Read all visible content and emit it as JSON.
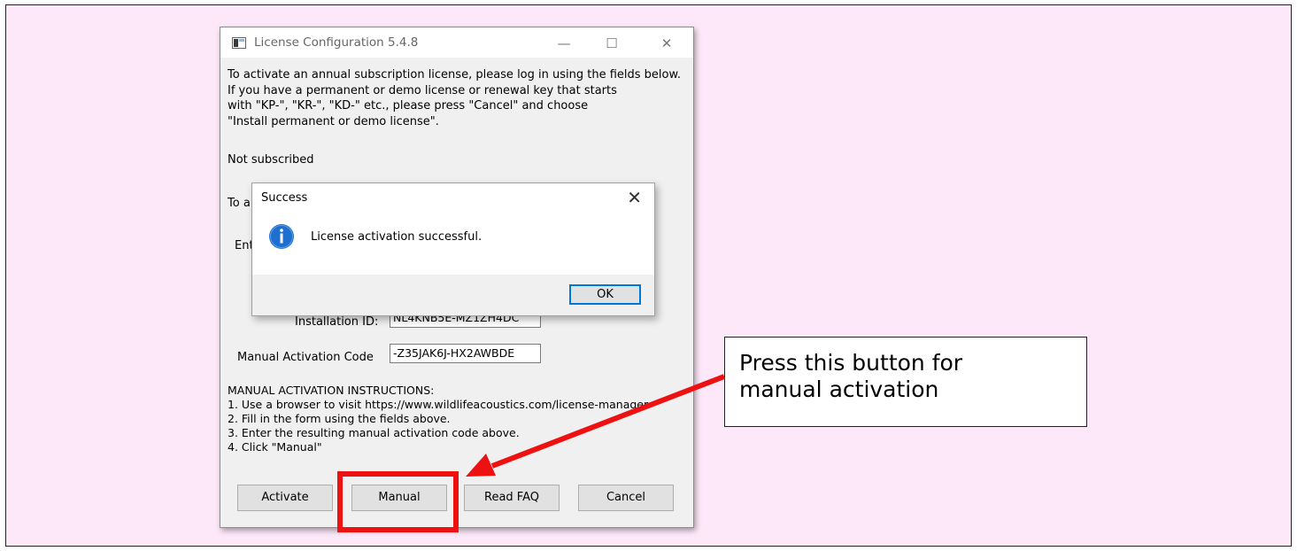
{
  "license_window": {
    "title": "License Configuration 5.4.8",
    "controls": {
      "minimize": "—",
      "maximize": "☐",
      "close": "✕"
    },
    "intro_text": "To activate an annual subscription license, please log in using the fields below.\nIf you have a permanent or demo license or renewal key that starts\nwith \"KP-\", \"KR-\", \"KD-\" etc., please press \"Cancel\" and choose\n\"Install permanent or demo license\".",
    "status": "Not subscribed",
    "partial_text_1": "To a",
    "partial_text_2": "Ent",
    "installation_id_label": "Installation ID:",
    "installation_id_value": "NL4KNB5E-MZ1ZH4DC",
    "manual_code_label": "Manual Activation Code",
    "manual_code_value": "-Z35JAK6J-HX2AWBDE",
    "instructions": "MANUAL ACTIVATION INSTRUCTIONS:\n1. Use a browser to visit https://www.wildlifeacoustics.com/license-manager\n2. Fill in the form using the fields above.\n3. Enter the resulting manual activation code above.\n4. Click \"Manual\"",
    "buttons": {
      "activate": "Activate",
      "manual": "Manual",
      "read_faq": "Read FAQ",
      "cancel": "Cancel"
    }
  },
  "success_dialog": {
    "title": "Success",
    "close": "✕",
    "message": "License activation successful.",
    "ok": "OK",
    "icon": "info-icon"
  },
  "annotation": {
    "callout_text": "Press this button for\nmanual activation",
    "highlight_color": "#ee1111",
    "arrow_color": "#ee1111"
  },
  "colors": {
    "background": "#fce8f8",
    "accent": "#0078d7",
    "info_icon": "#1f6fd0"
  }
}
